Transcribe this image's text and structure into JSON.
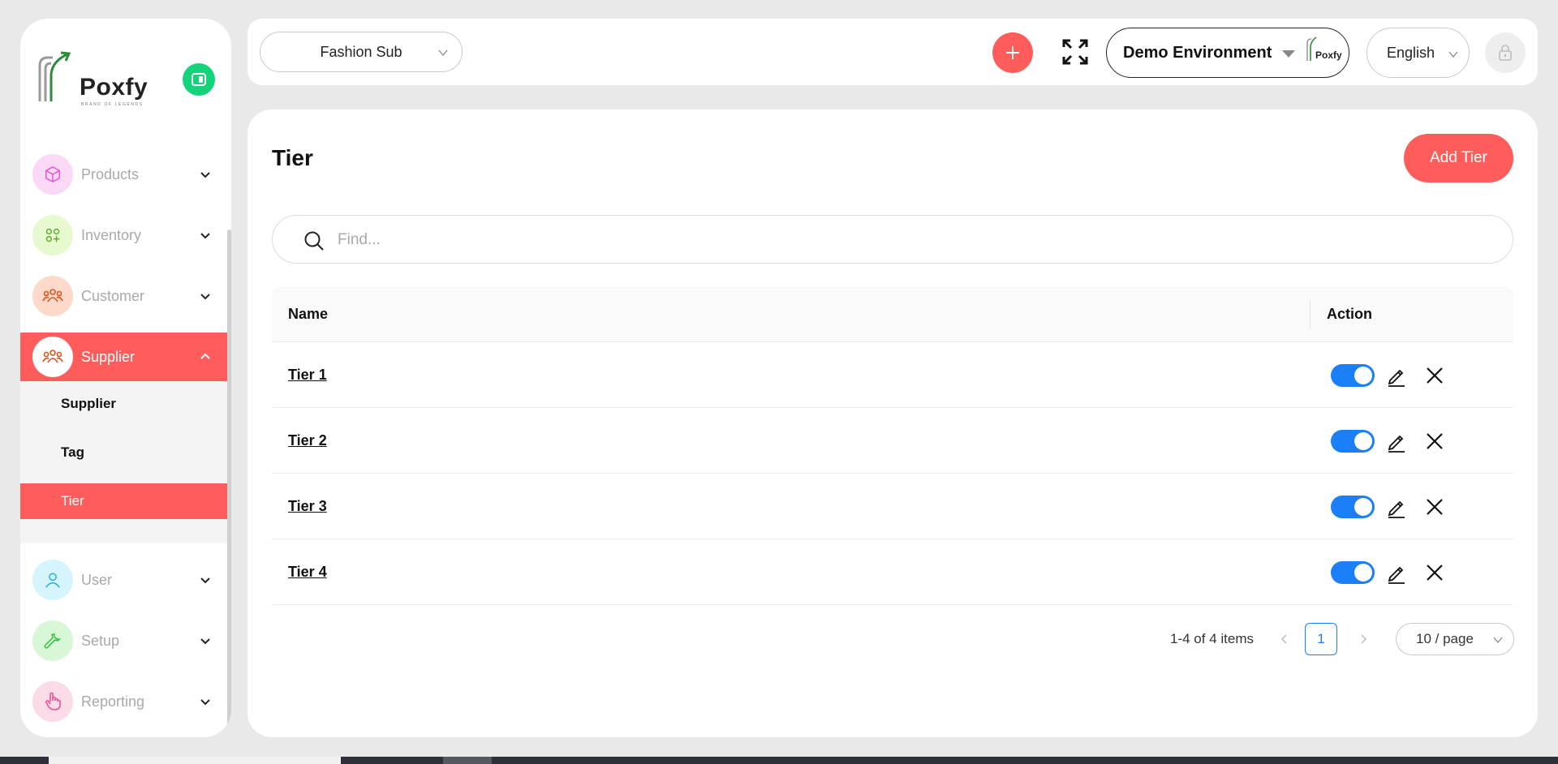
{
  "brand": {
    "name": "Poxfy",
    "tagline": "BRAND OF LEGENDS"
  },
  "sidebar": {
    "items": [
      {
        "label": "Products",
        "icon": "box-icon",
        "color": "#e94fd6",
        "bg": "#fbd9f6"
      },
      {
        "label": "Inventory",
        "icon": "apps-icon",
        "color": "#5fae2b",
        "bg": "#e6f9cf"
      },
      {
        "label": "Customer",
        "icon": "users-icon",
        "color": "#d9531e",
        "bg": "#fcd9c8"
      },
      {
        "label": "Supplier",
        "icon": "users-icon",
        "color": "#d9531e",
        "bg": "#ffffff"
      },
      {
        "label": "User",
        "icon": "user-icon",
        "color": "#1fb0d8",
        "bg": "#d5f4fb"
      },
      {
        "label": "Setup",
        "icon": "wrench-icon",
        "color": "#2fbf3b",
        "bg": "#d8f7d6"
      },
      {
        "label": "Reporting",
        "icon": "hand-icon",
        "color": "#e94f95",
        "bg": "#fcdbe8"
      }
    ],
    "submenu": [
      {
        "label": "Supplier"
      },
      {
        "label": "Tag"
      },
      {
        "label": "Tier"
      }
    ]
  },
  "header": {
    "store": "Fashion Sub",
    "environment": "Demo Environment",
    "env_logo_text": "Poxfy",
    "language": "English"
  },
  "main": {
    "title": "Tier",
    "add_button": "Add Tier",
    "search_placeholder": "Find...",
    "columns": {
      "name": "Name",
      "action": "Action"
    },
    "rows": [
      {
        "name": "Tier 1",
        "enabled": true
      },
      {
        "name": "Tier 2",
        "enabled": true
      },
      {
        "name": "Tier 3",
        "enabled": true
      },
      {
        "name": "Tier 4",
        "enabled": true
      }
    ],
    "pagination": {
      "total": "1-4 of 4 items",
      "page": "1",
      "page_size": "10 / page"
    }
  },
  "colors": {
    "accent": "#fe5d5c",
    "toggle": "#1b7ff7",
    "collapse": "#13d47a"
  }
}
